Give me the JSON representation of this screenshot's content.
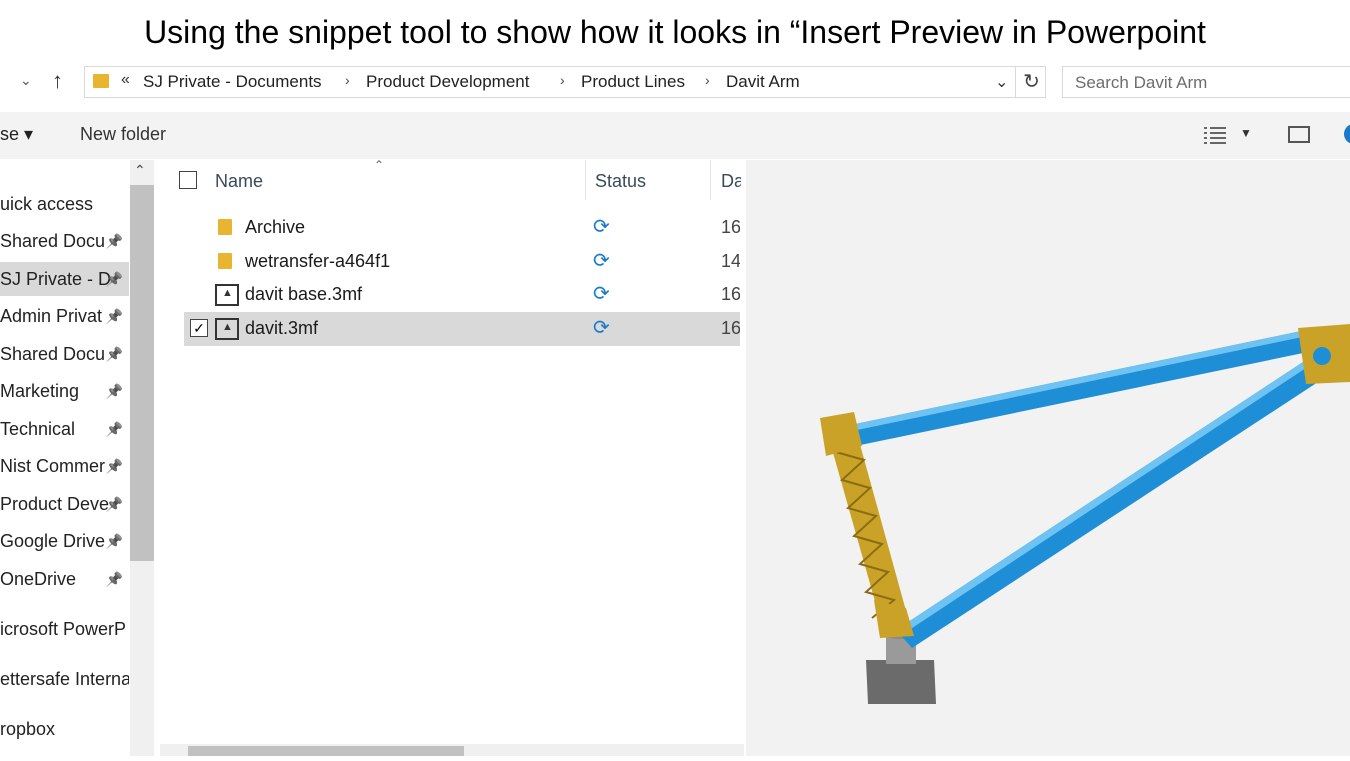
{
  "slide": {
    "title": "Using the snippet tool to show how it looks in “Insert Preview in Powerpoint"
  },
  "address": {
    "overflow_chevron": "«",
    "crumbs": [
      "SJ Private - Documents",
      "Product Development",
      "Product Lines",
      "Davit Arm"
    ],
    "separator": "›",
    "dropdown_icon": "chevron-down-icon",
    "refresh_icon": "refresh-icon"
  },
  "search": {
    "placeholder": "Search Davit Arm"
  },
  "toolbar": {
    "left_label": "se ▾",
    "new_folder": "New folder"
  },
  "nav": {
    "items": [
      {
        "label": "uick access",
        "pinned": false
      },
      {
        "label": "Shared Docu",
        "pinned": true
      },
      {
        "label": "SJ Private - D",
        "pinned": true,
        "selected": true
      },
      {
        "label": "Admin Privat",
        "pinned": true
      },
      {
        "label": "Shared Docu",
        "pinned": true
      },
      {
        "label": "Marketing",
        "pinned": true
      },
      {
        "label": "Technical",
        "pinned": true
      },
      {
        "label": "Nist Commer",
        "pinned": true
      },
      {
        "label": "Product Deve",
        "pinned": true
      },
      {
        "label": "Google Drive",
        "pinned": true
      },
      {
        "label": "OneDrive",
        "pinned": true
      },
      {
        "label": "icrosoft PowerP",
        "pinned": false
      },
      {
        "label": "ettersafe Interna",
        "pinned": false
      },
      {
        "label": "ropbox",
        "pinned": false
      }
    ]
  },
  "list": {
    "columns": {
      "name": "Name",
      "status": "Status",
      "date": "Da"
    },
    "rows": [
      {
        "name": "Archive",
        "type": "folder",
        "status_icon": "sync-icon",
        "date": "16,",
        "selected": false
      },
      {
        "name": "wetransfer-a464f1",
        "type": "folder",
        "status_icon": "sync-icon",
        "date": "14,",
        "selected": false
      },
      {
        "name": "davit base.3mf",
        "type": "3mf",
        "status_icon": "sync-icon",
        "date": "16,",
        "selected": false
      },
      {
        "name": "davit.3mf",
        "type": "3mf",
        "status_icon": "sync-icon",
        "date": "16,",
        "selected": true
      }
    ]
  },
  "preview": {
    "subject": "davit arm 3D model"
  },
  "colors": {
    "accent": "#1979ca",
    "selection": "#d9d9d9",
    "beam": "#1e8fd6",
    "truss": "#c9a227"
  }
}
